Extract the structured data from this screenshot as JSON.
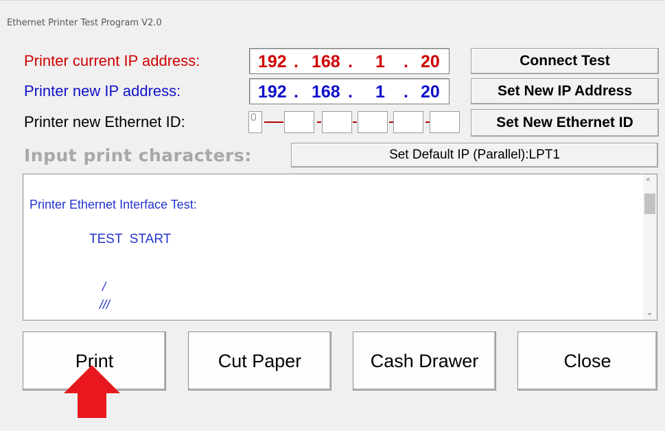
{
  "window": {
    "title": "Ethernet  Printer Test Program  V2.0"
  },
  "current_ip": {
    "label": "Printer current IP address:",
    "octets": [
      "192",
      "168",
      "1",
      "20"
    ],
    "color": "#d00000"
  },
  "new_ip": {
    "label": "Printer new IP address:",
    "octets": [
      "192",
      "168",
      "1",
      "20"
    ],
    "color": "#1010cc"
  },
  "ethernet_id": {
    "label": "Printer new Ethernet ID:",
    "first_value": "0",
    "fields": [
      "",
      "",
      "",
      "",
      ""
    ]
  },
  "buttons": {
    "connect_test": "Connect Test",
    "set_new_ip": "Set New IP Address",
    "set_new_ethernet_id": "Set New Ethernet ID",
    "set_default_ip": "Set Default IP (Parallel):LPT1"
  },
  "input_label": "Input print characters:",
  "print_text": {
    "lines": [
      "Printer Ethernet Interface Test:",
      "TEST  START",
      "/",
      "///"
    ]
  },
  "bottom_buttons": {
    "print": "Print",
    "cut_paper": "Cut Paper",
    "cash_drawer": "Cash Drawer",
    "close": "Close"
  },
  "annotation": {
    "arrow_color": "#e8181e",
    "arrow_target": "Print"
  }
}
